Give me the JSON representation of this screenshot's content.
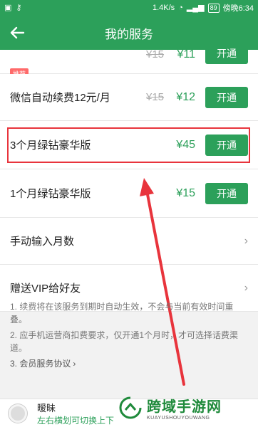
{
  "status_bar": {
    "speed": "1.4K/s",
    "battery": "89",
    "carrier_time": "傍晚6:34"
  },
  "app_bar": {
    "title": "我的服务"
  },
  "rows": [
    {
      "tag": "推荐",
      "old_price": "¥15",
      "price": "¥11",
      "button": "开通"
    },
    {
      "label": "微信自动续费12元/月",
      "old_price": "¥15",
      "price": "¥12",
      "button": "开通"
    },
    {
      "label": "3个月绿钻豪华版",
      "price": "¥45",
      "button": "开通"
    },
    {
      "label": "1个月绿钻豪华版",
      "price": "¥15",
      "button": "开通"
    },
    {
      "label": "手动输入月数"
    },
    {
      "label": "赠送VIP给好友"
    }
  ],
  "notes": {
    "line1": "1. 续费将在该服务到期时自动生效，不会与当前有效时间重叠。",
    "line2": "2. 应手机运营商扣费要求，仅开通1个月时，才可选择话费渠道。",
    "line3": "3. 会员服务协议"
  },
  "player": {
    "title": "暧昧",
    "hint": "左右横划可切换上下"
  },
  "watermark": {
    "cn": "跨域手游网",
    "en": "KUAYUSHOUYOUWANG"
  },
  "colors": {
    "brand_green": "#2ca05a",
    "highlight_red": "#e8343c"
  }
}
